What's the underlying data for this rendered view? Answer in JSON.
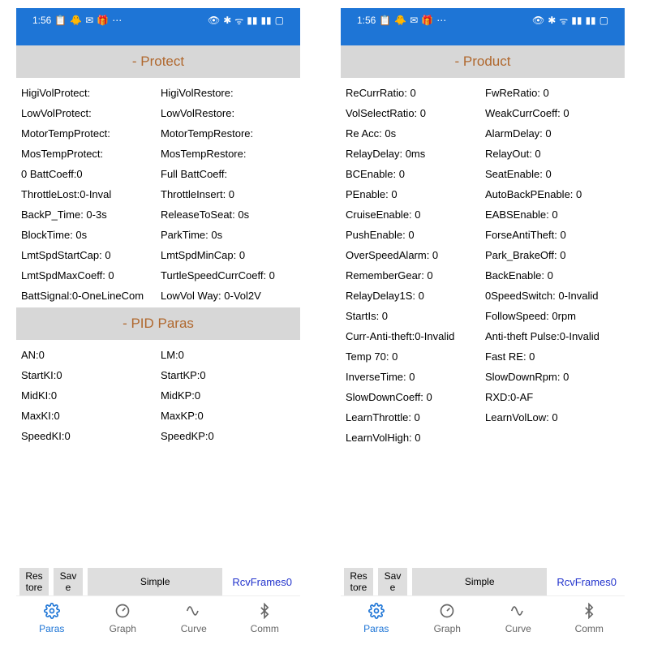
{
  "statusbar": {
    "time": "1:56",
    "left_icons": [
      "📋",
      "🐥",
      "✉",
      "🎁",
      "⋯"
    ],
    "right_icons": [
      "👁",
      "⚙",
      "ᯤ",
      "📶",
      "📶",
      "🔋"
    ]
  },
  "left": {
    "sections": {
      "protect": {
        "title": "- Protect",
        "rows": [
          [
            "HigiVolProtect:",
            "HigiVolRestore:"
          ],
          [
            "LowVolProtect:",
            "LowVolRestore:"
          ],
          [
            "MotorTempProtect:",
            "MotorTempRestore:"
          ],
          [
            "MosTempProtect:",
            "MosTempRestore:"
          ],
          [
            "0 BattCoeff:0",
            "Full BattCoeff:"
          ],
          [
            "ThrottleLost:0-Inval",
            "ThrottleInsert:   0"
          ],
          [
            "BackP_Time: 0-3s",
            "ReleaseToSeat:   0s"
          ],
          [
            "BlockTime:   0s",
            "ParkTime:   0s"
          ],
          [
            "LmtSpdStartCap:   0",
            "LmtSpdMinCap:   0"
          ],
          [
            "LmtSpdMaxCoeff:   0",
            "TurtleSpeedCurrCoeff:   0"
          ],
          [
            "BattSignal:0-OneLineCom",
            "LowVol Way: 0-Vol2V"
          ]
        ]
      },
      "pid": {
        "title": "- PID Paras",
        "rows": [
          [
            "AN:0",
            "LM:0"
          ],
          [
            "StartKI:0",
            "StartKP:0"
          ],
          [
            "MidKI:0",
            "MidKP:0"
          ],
          [
            "MaxKI:0",
            "MaxKP:0"
          ],
          [
            "SpeedKI:0",
            "SpeedKP:0"
          ]
        ]
      }
    }
  },
  "right": {
    "sections": {
      "product": {
        "title": "- Product",
        "rows": [
          [
            "ReCurrRatio:   0",
            "FwReRatio:   0"
          ],
          [
            "VolSelectRatio:   0",
            "WeakCurrCoeff:   0"
          ],
          [
            "Re Acc:   0s",
            "AlarmDelay:   0"
          ],
          [
            "RelayDelay:   0ms",
            "RelayOut:   0"
          ],
          [
            "BCEnable:   0",
            "SeatEnable:   0"
          ],
          [
            "PEnable:   0",
            "AutoBackPEnable:   0"
          ],
          [
            "CruiseEnable:   0",
            "EABSEnable:   0"
          ],
          [
            "PushEnable:   0",
            "ForseAntiTheft:   0"
          ],
          [
            "OverSpeedAlarm:   0",
            "Park_BrakeOff:   0"
          ],
          [
            "RememberGear:   0",
            "BackEnable:   0"
          ],
          [
            "RelayDelay1S:   0",
            "0SpeedSwitch: 0-Invalid"
          ],
          [
            "StartIs:   0",
            "FollowSpeed:   0rpm"
          ],
          [
            "Curr-Anti-theft:0-Invalid",
            "Anti-theft Pulse:0-Invalid"
          ],
          [
            "Temp 70: 0",
            "Fast RE: 0"
          ],
          [
            "InverseTime:   0",
            "SlowDownRpm:   0"
          ],
          [
            "SlowDownCoeff:   0",
            "RXD:0-AF"
          ],
          [
            "LearnThrottle:   0",
            "LearnVolLow:   0"
          ],
          [
            "LearnVolHigh:   0",
            ""
          ]
        ]
      }
    }
  },
  "bottom": {
    "restore": "Res\ntore",
    "save": "Sav\ne",
    "simple": "Simple",
    "rcv": "RcvFrames0"
  },
  "nav": {
    "paras": "Paras",
    "graph": "Graph",
    "curve": "Curve",
    "comm": "Comm"
  }
}
